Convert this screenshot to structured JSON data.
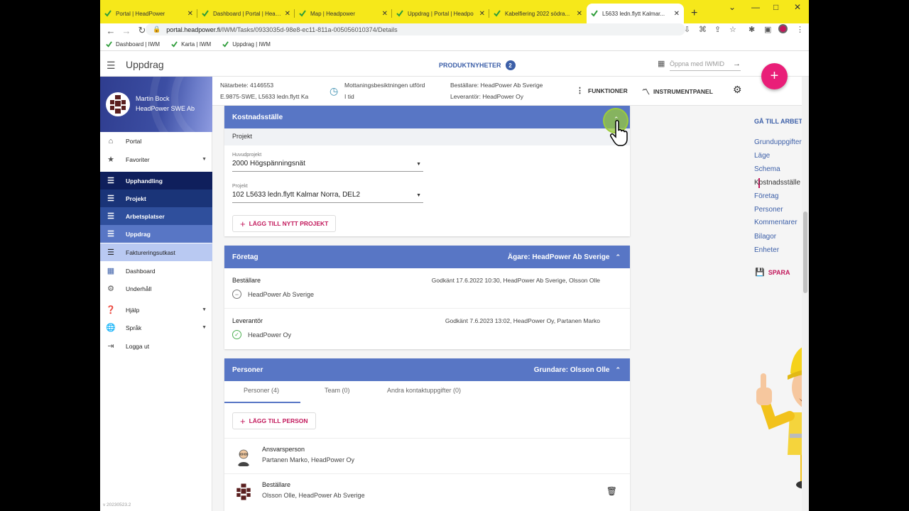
{
  "browser": {
    "tabs": [
      {
        "title": "Portal | HeadPower",
        "active": false
      },
      {
        "title": "Dashboard | Portal | Headp",
        "active": false
      },
      {
        "title": "Map | Headpower",
        "active": false
      },
      {
        "title": "Uppdrag | Portal | Headpo",
        "active": false
      },
      {
        "title": "Kabelfiering 2022 södra...",
        "active": false
      },
      {
        "title": "L5633 ledn.flytt Kalmar...",
        "active": true
      }
    ],
    "url_domain": "portal.headpower.fi",
    "url_path": "/IWM/Tasks/0933035d-98e8-ec11-811a-005056010374/Details",
    "bookmarks": [
      "Dashboard | IWM",
      "Karta | IWM",
      "Uppdrag | IWM"
    ]
  },
  "appbar": {
    "title": "Uppdrag",
    "product_news": "PRODUKTNYHETER",
    "product_news_count": "2",
    "iwmid_placeholder": "Öppna med IWMID"
  },
  "sidebar": {
    "user_name": "Martin Bock",
    "user_company": "HeadPower SWE Ab",
    "items": [
      {
        "label": "Portal",
        "icon": "home-icon"
      },
      {
        "label": "Favoriter",
        "icon": "star-icon"
      },
      {
        "label": "Upphandling",
        "icon": "list-icon"
      },
      {
        "label": "Projekt",
        "icon": "list-icon"
      },
      {
        "label": "Arbetsplatser",
        "icon": "list-icon"
      },
      {
        "label": "Uppdrag",
        "icon": "list-icon"
      },
      {
        "label": "Faktureringsutkast",
        "icon": "list-icon"
      },
      {
        "label": "Dashboard",
        "icon": "dashboard-icon"
      },
      {
        "label": "Underhåll",
        "icon": "gear-icon"
      },
      {
        "label": "Hjälp",
        "icon": "help-icon"
      },
      {
        "label": "Språk",
        "icon": "globe-icon"
      },
      {
        "label": "Logga ut",
        "icon": "logout-icon"
      }
    ],
    "version": "v 20230523.2"
  },
  "infobar": {
    "natarbete": "Nätarbete: 4146553",
    "task_code": "E.9875-SWE, L5633 ledn.flytt Ka",
    "status_line1": "Mottaningsbesiktningen utförd",
    "status_line2": "I tid",
    "bestallare": "Beställare: HeadPower Ab Sverige",
    "leverantor": "Leverantör: HeadPower Oy",
    "funktioner": "FUNKTIONER",
    "instrumentpanel": "INSTRUMENTPANEL"
  },
  "kostnadsstalle": {
    "title": "Kostnadsställe",
    "section": "Projekt",
    "huvudprojekt_label": "Huvudprojekt",
    "huvudprojekt_value": "2000 Högspänningsnät",
    "projekt_label": "Projekt",
    "projekt_value": "102 L5633 ledn.flytt Kalmar Norra, DEL2",
    "add_button": "LÄGG TILL NYTT PROJEKT"
  },
  "foretag": {
    "title": "Företag",
    "owner": "Ägare: HeadPower Ab Sverige",
    "rows": [
      {
        "role": "Beställare",
        "approved": "Godkänt 17.6.2022 10:30, HeadPower Ab Sverige, Olsson Olle",
        "company": "HeadPower Ab Sverige",
        "status": "neutral"
      },
      {
        "role": "Leverantör",
        "approved": "Godkänt 7.6.2023 13:02, HeadPower Oy, Partanen Marko",
        "company": "HeadPower Oy",
        "status": "ok"
      }
    ]
  },
  "personer": {
    "title": "Personer",
    "founder": "Grundare: Olsson Olle",
    "tabs": [
      "Personer (4)",
      "Team (0)",
      "Andra kontaktuppgifter (0)"
    ],
    "add_button": "LÄGG TILL PERSON",
    "people": [
      {
        "title": "Ansvarsperson",
        "detail": "Partanen Marko, HeadPower Oy"
      },
      {
        "title": "Beställare",
        "detail": "Olsson Olle, HeadPower Ab Sverige"
      }
    ]
  },
  "rightnav": {
    "goto": "GÅ TILL ARBETSPLATSEN",
    "links": [
      "Grunduppgifter",
      "Läge",
      "Schema",
      "Kostnadsställe",
      "Företag",
      "Personer",
      "Kommentarer",
      "Bilagor",
      "Enheter"
    ],
    "active": "Kostnadsställe",
    "save": "SPARA"
  },
  "colors": {
    "browser_chrome": "#f6e81a",
    "card_header": "#5876c5",
    "accent_pink": "#e91e78",
    "link_blue": "#3c5fa8"
  }
}
